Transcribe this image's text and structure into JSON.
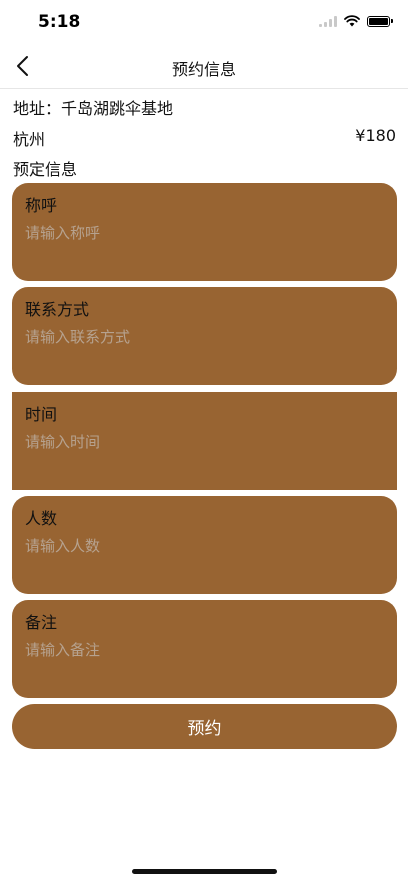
{
  "status_bar": {
    "time": "5:18"
  },
  "nav": {
    "title": "预约信息",
    "back_icon": "chevron-left-icon"
  },
  "info": {
    "address": "地址：千岛湖跳伞基地",
    "city": "杭州",
    "price": "¥180",
    "section_title": "预定信息"
  },
  "form": {
    "fields": [
      {
        "label": "称呼",
        "placeholder": "请输入称呼",
        "value": ""
      },
      {
        "label": "联系方式",
        "placeholder": "请输入联系方式",
        "value": ""
      },
      {
        "label": "时间",
        "placeholder": "请输入时间",
        "value": ""
      },
      {
        "label": "人数",
        "placeholder": "请输入人数",
        "value": ""
      },
      {
        "label": "备注",
        "placeholder": "请输入备注",
        "value": ""
      }
    ],
    "submit_label": "预约"
  },
  "colors": {
    "accent": "#986432",
    "background": "#ffffff",
    "placeholder": "#b6a28f"
  }
}
